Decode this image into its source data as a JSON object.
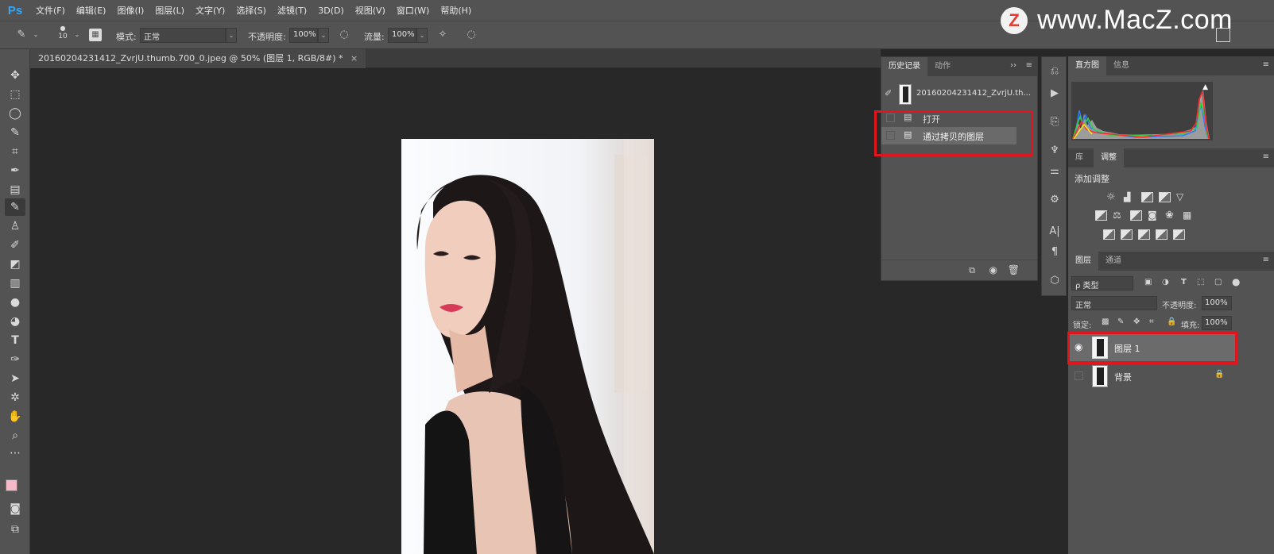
{
  "app": {
    "logo": "Ps"
  },
  "menu": [
    "文件(F)",
    "编辑(E)",
    "图像(I)",
    "图层(L)",
    "文字(Y)",
    "选择(S)",
    "滤镜(T)",
    "3D(D)",
    "视图(V)",
    "窗口(W)",
    "帮助(H)"
  ],
  "watermark": {
    "logo": "Z",
    "text": "www.MacZ.com"
  },
  "options": {
    "brush_size": "10",
    "mode_label": "模式:",
    "mode_value": "正常",
    "opacity_label": "不透明度:",
    "opacity_value": "100%",
    "flow_label": "流量:",
    "flow_value": "100%"
  },
  "document": {
    "tab_title": "20160204231412_ZvrjU.thumb.700_0.jpeg @ 50% (图层 1, RGB/8#) *"
  },
  "history": {
    "tabs": [
      "历史记录",
      "动作"
    ],
    "snapshot_name": "20160204231412_ZvrjU.th...",
    "states": [
      "打开",
      "通过拷贝的图层"
    ]
  },
  "histogram": {
    "tabs": [
      "直方图",
      "信息"
    ]
  },
  "adjustments": {
    "tabs": [
      "库",
      "调整"
    ],
    "title": "添加调整"
  },
  "layers_panel": {
    "tabs": [
      "图层",
      "通道"
    ],
    "filter_label": "ρ 类型",
    "blend_mode": "正常",
    "opacity_label": "不透明度:",
    "opacity_value": "100%",
    "lock_label": "锁定:",
    "fill_label": "填充:",
    "fill_value": "100%",
    "layers": [
      {
        "name": "图层 1",
        "visible": true,
        "selected": true
      },
      {
        "name": "背景",
        "visible": false,
        "locked": true
      }
    ]
  },
  "colors": {
    "accent_red": "#e0161c",
    "foreground": "#f5b9c8",
    "background": "#ffffff"
  }
}
